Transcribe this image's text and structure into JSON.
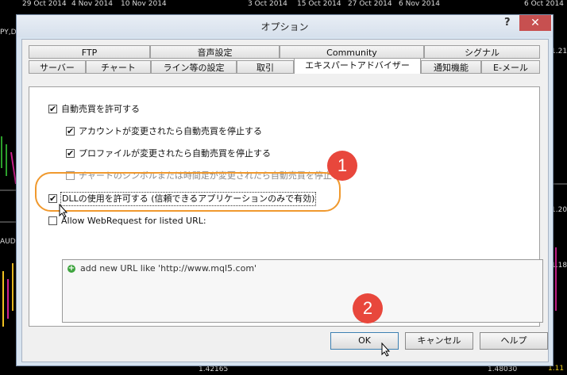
{
  "background": {
    "dates_left": [
      "29 Oct 2014",
      "4 Nov 2014",
      "10 Nov 2014"
    ],
    "dates_right": [
      "3 Oct 2014",
      "15 Oct 2014",
      "27 Oct 2014",
      "6 Nov 2014"
    ],
    "date_far_right": "6 Oct 2014",
    "left_label_1": "PY,D",
    "left_label_2": "AUD",
    "right_prices": [
      "1.21",
      "1.20",
      "1.18"
    ],
    "bottom_prices": [
      "1.42165",
      "1.48030"
    ],
    "bottom_right_price": "1.11"
  },
  "dialog": {
    "title": "オプション",
    "help_label": "?",
    "close_label": "✕",
    "tabs_row1": [
      "FTP",
      "音声設定",
      "Community",
      "シグナル"
    ],
    "tabs_row2": [
      "サーバー",
      "チャート",
      "ライン等の設定",
      "取引",
      "エキスパートアドバイザー",
      "通知機能",
      "E-メール"
    ],
    "options": {
      "allow_auto_trading": {
        "label": "自動売買を許可する",
        "checked": true
      },
      "stop_on_account_change": {
        "label": "アカウントが変更されたら自動売買を停止する",
        "checked": true
      },
      "stop_on_profile_change": {
        "label": "プロファイルが変更されたら自動売買を停止する",
        "checked": true
      },
      "stop_on_symbol_change": {
        "label": "チャートのシンボルまたは時間足が変更されたら自動売買を停止する",
        "checked": false
      },
      "allow_dll": {
        "label": "DLLの使用を許可する (信頼できるアプリケーションのみで有効)",
        "checked": true
      },
      "allow_webrequest": {
        "label": "Allow WebRequest for listed URL:",
        "checked": false
      }
    },
    "url_list": {
      "add_text": "add new URL like 'http://www.mql5.com'"
    },
    "buttons": {
      "ok": "OK",
      "cancel": "キャンセル",
      "help": "ヘルプ"
    }
  },
  "annotations": {
    "badge1": "1",
    "badge2": "2"
  }
}
